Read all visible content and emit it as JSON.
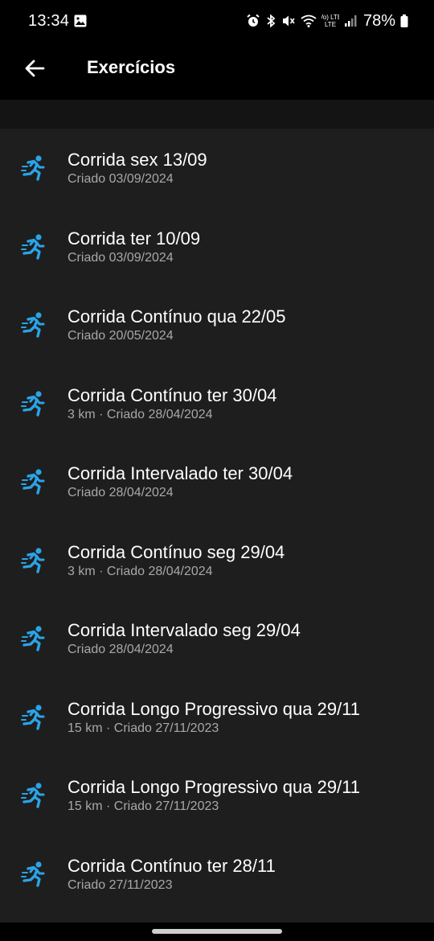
{
  "status_bar": {
    "time": "13:34",
    "network_label": "Vo) LTE",
    "battery": "78%",
    "icons": [
      "image-icon",
      "alarm-icon",
      "bluetooth-icon",
      "mute-icon",
      "wifi-icon",
      "volte-icon",
      "signal-icon",
      "battery-icon"
    ]
  },
  "app_bar": {
    "title": "Exercícios",
    "back_icon": "arrow-left-icon"
  },
  "colors": {
    "accent": "#2aa4e8",
    "list_background": "#1e1e1e",
    "subtitle": "#a8a8a8"
  },
  "exercises": [
    {
      "title": "Corrida  sex 13/09",
      "subtitle": "Criado 03/09/2024",
      "icon": "runner-icon"
    },
    {
      "title": "Corrida  ter 10/09",
      "subtitle": "Criado 03/09/2024",
      "icon": "runner-icon"
    },
    {
      "title": "Corrida Contínuo qua 22/05",
      "subtitle": "Criado 20/05/2024",
      "icon": "runner-icon"
    },
    {
      "title": "Corrida Contínuo ter 30/04",
      "subtitle": "3 km · Criado 28/04/2024",
      "icon": "runner-icon"
    },
    {
      "title": "Corrida Intervalado ter 30/04",
      "subtitle": "Criado 28/04/2024",
      "icon": "runner-icon"
    },
    {
      "title": "Corrida Contínuo seg 29/04",
      "subtitle": "3 km · Criado 28/04/2024",
      "icon": "runner-icon"
    },
    {
      "title": "Corrida Intervalado seg 29/04",
      "subtitle": "Criado 28/04/2024",
      "icon": "runner-icon"
    },
    {
      "title": "Corrida Longo Progressivo qua 29/11",
      "subtitle": "15 km · Criado 27/11/2023",
      "icon": "runner-icon"
    },
    {
      "title": "Corrida Longo Progressivo qua 29/11",
      "subtitle": "15 km · Criado 27/11/2023",
      "icon": "runner-icon"
    },
    {
      "title": "Corrida Contínuo ter 28/11",
      "subtitle": "Criado 27/11/2023",
      "icon": "runner-icon"
    }
  ]
}
